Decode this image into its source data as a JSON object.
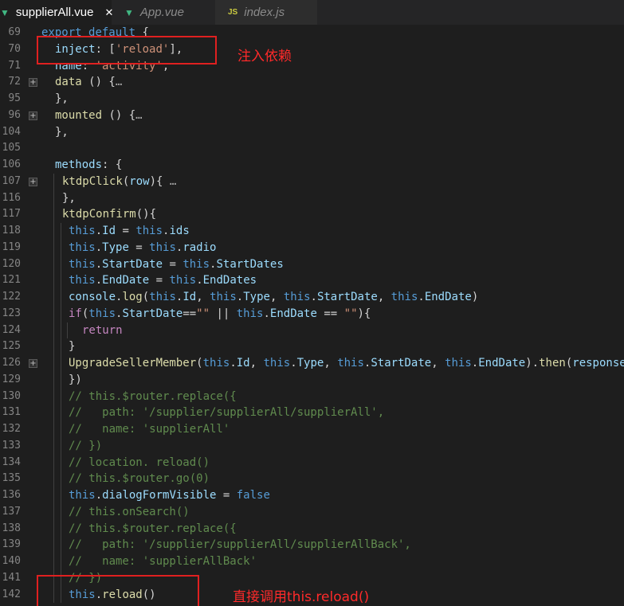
{
  "tabs": [
    {
      "label": "supplierAll.vue",
      "icon": "vue-icon",
      "active": true,
      "close": "✕"
    },
    {
      "label": "App.vue",
      "icon": "vue-icon",
      "active": false
    },
    {
      "label": "index.js",
      "icon": "js-icon",
      "active": false,
      "badge": "JS"
    }
  ],
  "lines": [
    {
      "n": "69",
      "fold": false,
      "indent": 0,
      "tokens": [
        [
          "kw",
          "export "
        ],
        [
          "kw",
          "default "
        ],
        [
          "text",
          "{"
        ]
      ]
    },
    {
      "n": "70",
      "fold": false,
      "indent": 1,
      "tokens": [
        [
          "prop",
          "inject"
        ],
        [
          "text",
          ": ["
        ],
        [
          "str",
          "'reload'"
        ],
        [
          "text",
          "],"
        ]
      ]
    },
    {
      "n": "71",
      "fold": false,
      "indent": 1,
      "tokens": [
        [
          "prop",
          "name"
        ],
        [
          "text",
          ": "
        ],
        [
          "str",
          "'activity'"
        ],
        [
          "text",
          ","
        ]
      ]
    },
    {
      "n": "72",
      "fold": true,
      "indent": 1,
      "tokens": [
        [
          "fn",
          "data"
        ],
        [
          "text",
          " () {"
        ],
        [
          "fold",
          "…"
        ]
      ]
    },
    {
      "n": "95",
      "fold": false,
      "indent": 1,
      "tokens": [
        [
          "text",
          "},"
        ]
      ]
    },
    {
      "n": "96",
      "fold": true,
      "indent": 1,
      "tokens": [
        [
          "fn",
          "mounted"
        ],
        [
          "text",
          " () {"
        ],
        [
          "fold",
          "…"
        ]
      ]
    },
    {
      "n": "104",
      "fold": false,
      "indent": 1,
      "tokens": [
        [
          "text",
          "},"
        ]
      ]
    },
    {
      "n": "105",
      "fold": false,
      "indent": 0,
      "tokens": []
    },
    {
      "n": "106",
      "fold": false,
      "indent": 1,
      "tokens": [
        [
          "prop",
          "methods"
        ],
        [
          "text",
          ": {"
        ]
      ]
    },
    {
      "n": "107",
      "fold": true,
      "indent": 2,
      "tokens": [
        [
          "fn",
          "ktdpClick"
        ],
        [
          "text",
          "("
        ],
        [
          "prop",
          "row"
        ],
        [
          "text",
          "){ "
        ],
        [
          "fold",
          "…"
        ]
      ]
    },
    {
      "n": "116",
      "fold": false,
      "indent": 2,
      "tokens": [
        [
          "text",
          "},"
        ]
      ]
    },
    {
      "n": "117",
      "fold": false,
      "indent": 2,
      "tokens": [
        [
          "fn",
          "ktdpConfirm"
        ],
        [
          "text",
          "(){"
        ]
      ]
    },
    {
      "n": "118",
      "fold": false,
      "indent": 3,
      "tokens": [
        [
          "this",
          "this"
        ],
        [
          "text",
          "."
        ],
        [
          "prop",
          "Id"
        ],
        [
          "text",
          " = "
        ],
        [
          "this",
          "this"
        ],
        [
          "text",
          "."
        ],
        [
          "prop",
          "ids"
        ]
      ]
    },
    {
      "n": "119",
      "fold": false,
      "indent": 3,
      "tokens": [
        [
          "this",
          "this"
        ],
        [
          "text",
          "."
        ],
        [
          "prop",
          "Type"
        ],
        [
          "text",
          " = "
        ],
        [
          "this",
          "this"
        ],
        [
          "text",
          "."
        ],
        [
          "prop",
          "radio"
        ]
      ]
    },
    {
      "n": "120",
      "fold": false,
      "indent": 3,
      "tokens": [
        [
          "this",
          "this"
        ],
        [
          "text",
          "."
        ],
        [
          "prop",
          "StartDate"
        ],
        [
          "text",
          " = "
        ],
        [
          "this",
          "this"
        ],
        [
          "text",
          "."
        ],
        [
          "prop",
          "StartDates"
        ]
      ]
    },
    {
      "n": "121",
      "fold": false,
      "indent": 3,
      "tokens": [
        [
          "this",
          "this"
        ],
        [
          "text",
          "."
        ],
        [
          "prop",
          "EndDate"
        ],
        [
          "text",
          " = "
        ],
        [
          "this",
          "this"
        ],
        [
          "text",
          "."
        ],
        [
          "prop",
          "EndDates"
        ]
      ]
    },
    {
      "n": "122",
      "fold": false,
      "indent": 3,
      "tokens": [
        [
          "prop",
          "console"
        ],
        [
          "text",
          "."
        ],
        [
          "fn",
          "log"
        ],
        [
          "text",
          "("
        ],
        [
          "this",
          "this"
        ],
        [
          "text",
          "."
        ],
        [
          "prop",
          "Id"
        ],
        [
          "text",
          ", "
        ],
        [
          "this",
          "this"
        ],
        [
          "text",
          "."
        ],
        [
          "prop",
          "Type"
        ],
        [
          "text",
          ", "
        ],
        [
          "this",
          "this"
        ],
        [
          "text",
          "."
        ],
        [
          "prop",
          "StartDate"
        ],
        [
          "text",
          ", "
        ],
        [
          "this",
          "this"
        ],
        [
          "text",
          "."
        ],
        [
          "prop",
          "EndDate"
        ],
        [
          "text",
          ")"
        ]
      ]
    },
    {
      "n": "123",
      "fold": false,
      "indent": 3,
      "tokens": [
        [
          "ctrl",
          "if"
        ],
        [
          "text",
          "("
        ],
        [
          "this",
          "this"
        ],
        [
          "text",
          "."
        ],
        [
          "prop",
          "StartDate"
        ],
        [
          "text",
          "=="
        ],
        [
          "str",
          "\"\""
        ],
        [
          "text",
          " || "
        ],
        [
          "this",
          "this"
        ],
        [
          "text",
          "."
        ],
        [
          "prop",
          "EndDate"
        ],
        [
          "text",
          " == "
        ],
        [
          "str",
          "\"\""
        ],
        [
          "text",
          "){"
        ]
      ]
    },
    {
      "n": "124",
      "fold": false,
      "indent": 4,
      "tokens": [
        [
          "ctrl",
          "return"
        ]
      ]
    },
    {
      "n": "125",
      "fold": false,
      "indent": 3,
      "tokens": [
        [
          "text",
          "}"
        ]
      ]
    },
    {
      "n": "126",
      "fold": true,
      "indent": 3,
      "tokens": [
        [
          "fn",
          "UpgradeSellerMember"
        ],
        [
          "text",
          "("
        ],
        [
          "this",
          "this"
        ],
        [
          "text",
          "."
        ],
        [
          "prop",
          "Id"
        ],
        [
          "text",
          ", "
        ],
        [
          "this",
          "this"
        ],
        [
          "text",
          "."
        ],
        [
          "prop",
          "Type"
        ],
        [
          "text",
          ", "
        ],
        [
          "this",
          "this"
        ],
        [
          "text",
          "."
        ],
        [
          "prop",
          "StartDate"
        ],
        [
          "text",
          ", "
        ],
        [
          "this",
          "this"
        ],
        [
          "text",
          "."
        ],
        [
          "prop",
          "EndDate"
        ],
        [
          "text",
          ")."
        ],
        [
          "fn",
          "then"
        ],
        [
          "text",
          "("
        ],
        [
          "prop",
          "response"
        ]
      ]
    },
    {
      "n": "129",
      "fold": false,
      "indent": 3,
      "tokens": [
        [
          "text",
          "})"
        ]
      ]
    },
    {
      "n": "130",
      "fold": false,
      "indent": 3,
      "tokens": [
        [
          "cmt",
          "// this.$router.replace({"
        ]
      ]
    },
    {
      "n": "131",
      "fold": false,
      "indent": 3,
      "tokens": [
        [
          "cmt",
          "//   path: '/supplier/supplierAll/supplierAll',"
        ]
      ]
    },
    {
      "n": "132",
      "fold": false,
      "indent": 3,
      "tokens": [
        [
          "cmt",
          "//   name: 'supplierAll'"
        ]
      ]
    },
    {
      "n": "133",
      "fold": false,
      "indent": 3,
      "tokens": [
        [
          "cmt",
          "// })"
        ]
      ]
    },
    {
      "n": "134",
      "fold": false,
      "indent": 3,
      "tokens": [
        [
          "cmt",
          "// location. reload()"
        ]
      ]
    },
    {
      "n": "135",
      "fold": false,
      "indent": 3,
      "tokens": [
        [
          "cmt",
          "// this.$router.go(0)"
        ]
      ]
    },
    {
      "n": "136",
      "fold": false,
      "indent": 3,
      "tokens": [
        [
          "this",
          "this"
        ],
        [
          "text",
          "."
        ],
        [
          "prop",
          "dialogFormVisible"
        ],
        [
          "text",
          " = "
        ],
        [
          "bool",
          "false"
        ]
      ]
    },
    {
      "n": "137",
      "fold": false,
      "indent": 3,
      "tokens": [
        [
          "cmt",
          "// this.onSearch()"
        ]
      ]
    },
    {
      "n": "138",
      "fold": false,
      "indent": 3,
      "tokens": [
        [
          "cmt",
          "// this.$router.replace({"
        ]
      ]
    },
    {
      "n": "139",
      "fold": false,
      "indent": 3,
      "tokens": [
        [
          "cmt",
          "//   path: '/supplier/supplierAll/supplierAllBack',"
        ]
      ]
    },
    {
      "n": "140",
      "fold": false,
      "indent": 3,
      "tokens": [
        [
          "cmt",
          "//   name: 'supplierAllBack'"
        ]
      ]
    },
    {
      "n": "141",
      "fold": false,
      "indent": 3,
      "tokens": [
        [
          "cmt",
          "// })"
        ]
      ]
    },
    {
      "n": "142",
      "fold": false,
      "indent": 3,
      "tokens": [
        [
          "this",
          "this"
        ],
        [
          "text",
          "."
        ],
        [
          "fn",
          "reload"
        ],
        [
          "text",
          "()"
        ]
      ]
    }
  ],
  "annotations": {
    "inject_note": "注入依赖",
    "reload_note": "直接调用this.reload()"
  },
  "colors": {
    "background": "#1e1e1e",
    "tabbar": "#252526",
    "highlight_box": "#e02020",
    "annotation_text": "#ff2a2a"
  }
}
